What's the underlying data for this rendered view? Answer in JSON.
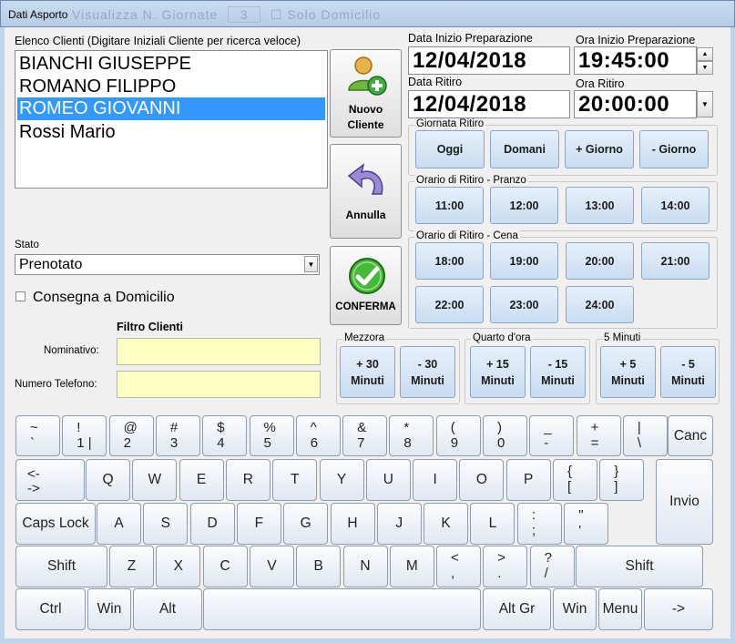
{
  "window": {
    "title": "Dati Asporto",
    "ghost_text": "Visualizza N. Giornate",
    "ghost_spin": "3",
    "ghost_check": "Solo Domicilio"
  },
  "clients": {
    "label": "Elenco Clienti (Digitare Iniziali Cliente per ricerca veloce)",
    "items": [
      "BIANCHI GIUSEPPE",
      "ROMANO FILIPPO",
      "ROMEO GIOVANNI",
      "Rossi Mario"
    ],
    "selected_index": 2
  },
  "side_buttons": {
    "new_client_line1": "Nuovo",
    "new_client_line2": "Cliente",
    "cancel": "Annulla",
    "confirm": "CONFERMA"
  },
  "stato": {
    "label": "Stato",
    "value": "Prenotato"
  },
  "delivery": {
    "label": "Consegna a Domicilio",
    "checked": false
  },
  "filter": {
    "title": "Filtro Clienti",
    "name_label": "Nominativo:",
    "name_value": "",
    "phone_label": "Numero Telefono:",
    "phone_value": ""
  },
  "dates": {
    "prep_date_label": "Data Inizio Preparazione",
    "prep_date": "12/04/2018",
    "prep_time_label": "Ora Inizio Preparazione",
    "prep_time": "19:45:00",
    "pickup_date_label": "Data Ritiro",
    "pickup_date": "12/04/2018",
    "pickup_time_label": "Ora Ritiro",
    "pickup_time": "20:00:00"
  },
  "day_group": {
    "title": "Giornata Ritiro",
    "buttons": [
      "Oggi",
      "Domani",
      "+ Giorno",
      "- Giorno"
    ]
  },
  "lunch_group": {
    "title": "Orario di Ritiro - Pranzo",
    "buttons": [
      "11:00",
      "12:00",
      "13:00",
      "14:00"
    ]
  },
  "dinner_group": {
    "title": "Orario di Ritiro - Cena",
    "buttons": [
      "18:00",
      "19:00",
      "20:00",
      "21:00",
      "22:00",
      "23:00",
      "24:00"
    ]
  },
  "half_hour": {
    "title": "Mezzora",
    "plus": "+ 30\nMinuti",
    "minus": "- 30\nMinuti"
  },
  "quarter": {
    "title": "Quarto d'ora",
    "plus": "+ 15\nMinuti",
    "minus": "- 15\nMinuti"
  },
  "five": {
    "title": "5 Minuti",
    "plus": "+ 5\nMinuti",
    "minus": "- 5\nMinuti"
  },
  "keyboard": {
    "row1": [
      [
        "~",
        "`"
      ],
      [
        "!",
        "1 |"
      ],
      [
        "@",
        "2"
      ],
      [
        "#",
        "3"
      ],
      [
        "$",
        "4"
      ],
      [
        "%",
        "5"
      ],
      [
        "^",
        "6"
      ],
      [
        "&",
        "7"
      ],
      [
        "*",
        "8"
      ],
      [
        "(",
        "9"
      ],
      [
        ")",
        "0"
      ],
      [
        "_",
        "-"
      ],
      [
        "+",
        "="
      ],
      [
        "|",
        "\\"
      ]
    ],
    "canc": "Canc",
    "tab_top": "<-",
    "tab_bottom": "->",
    "row2": [
      "Q",
      "W",
      "E",
      "R",
      "T",
      "Y",
      "U",
      "I",
      "O",
      "P"
    ],
    "row2_sym": [
      [
        "{",
        "["
      ],
      [
        "}",
        "]"
      ]
    ],
    "enter": "Invio",
    "caps": "Caps Lock",
    "row3": [
      "A",
      "S",
      "D",
      "F",
      "G",
      "H",
      "J",
      "K",
      "L"
    ],
    "row3_sym": [
      [
        ":",
        ";"
      ],
      [
        "\"",
        "'"
      ]
    ],
    "shift": "Shift",
    "row4": [
      "Z",
      "X",
      "C",
      "V",
      "B",
      "N",
      "M"
    ],
    "row4_sym": [
      [
        "<",
        ","
      ],
      [
        ">",
        "."
      ],
      [
        "?",
        "/"
      ]
    ],
    "ctrl": "Ctrl",
    "win": "Win",
    "alt": "Alt",
    "altgr": "Alt Gr",
    "menu": "Menu",
    "arrow": "->"
  }
}
